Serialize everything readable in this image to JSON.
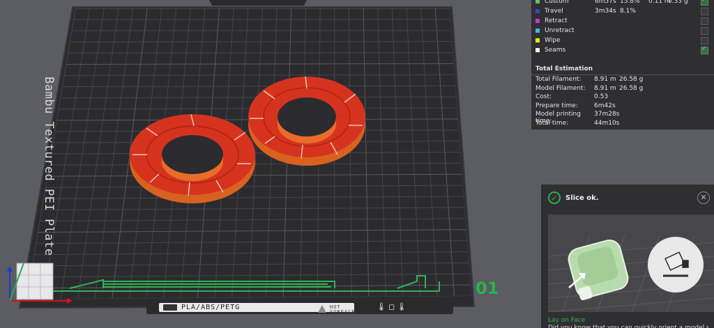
{
  "plate": {
    "name": "Bambu Textured PEI Plate",
    "number": "01",
    "material_label": "PLA/ABS/PETG",
    "warning_label_1": "HOT",
    "warning_label_2": "SURFACE"
  },
  "legend": {
    "rows": [
      {
        "name": "Custom",
        "time": "6m57s",
        "percent": "15.8%",
        "length": "0.11 m",
        "weight": "0.33 g",
        "color": "#5bc26a",
        "checked": true
      },
      {
        "name": "Travel",
        "time": "3m34s",
        "percent": "8.1%",
        "length": "",
        "weight": "",
        "color": "#3a46b8",
        "checked": false
      },
      {
        "name": "Retract",
        "time": "",
        "percent": "",
        "length": "",
        "weight": "",
        "color": "#c43ad3",
        "checked": false
      },
      {
        "name": "Unretract",
        "time": "",
        "percent": "",
        "length": "",
        "weight": "",
        "color": "#4ab3d6",
        "checked": false
      },
      {
        "name": "Wipe",
        "time": "",
        "percent": "",
        "length": "",
        "weight": "",
        "color": "#e6e619",
        "checked": false
      },
      {
        "name": "Seams",
        "time": "",
        "percent": "",
        "length": "",
        "weight": "",
        "color": "#f0f0f0",
        "checked": true
      }
    ]
  },
  "estimation": {
    "title": "Total Estimation",
    "rows": [
      {
        "label": "Total Filament:",
        "v1": "8.91 m",
        "v2": "26.58 g"
      },
      {
        "label": "Model Filament:",
        "v1": "8.91 m",
        "v2": "26.58 g"
      },
      {
        "label": "Cost:",
        "v1": "0.53",
        "v2": ""
      },
      {
        "label": "Prepare time:",
        "v1": "6m42s",
        "v2": ""
      },
      {
        "label": "Model printing time:",
        "v1": "37m28s",
        "v2": ""
      },
      {
        "label": "Total time:",
        "v1": "44m10s",
        "v2": ""
      }
    ]
  },
  "slice": {
    "status": "Slice ok.",
    "tip_title": "Lay on Face",
    "tip_desc": "Did you know that you can quickly orient a model so that one of its faces sits on the print bed?"
  }
}
